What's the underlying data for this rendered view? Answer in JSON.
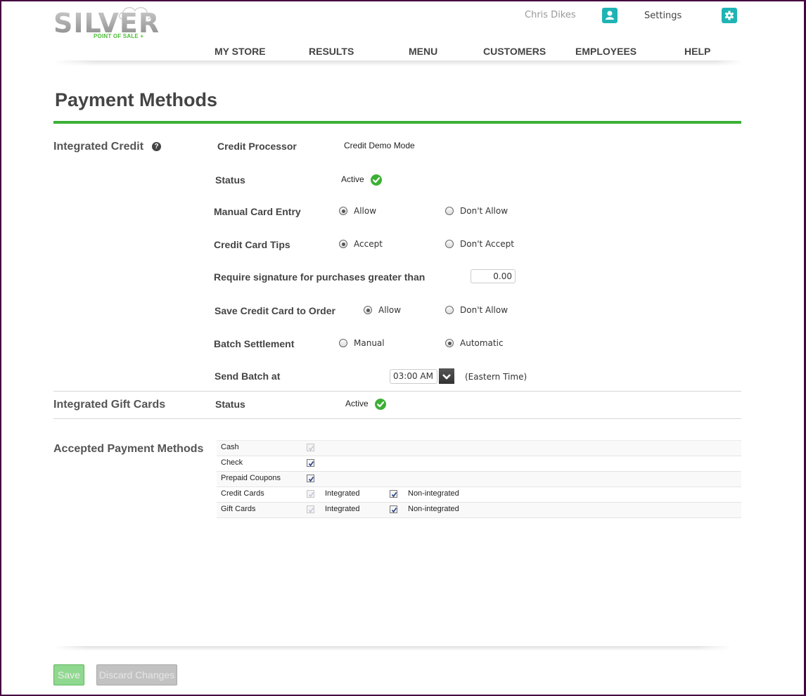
{
  "brand": {
    "name": "SILVER",
    "tagline": "POINT OF SALE +",
    "accent": "#3cb035",
    "teal": "#1fb4b4",
    "frame": "#44063f"
  },
  "header": {
    "user_name": "Chris Dikes",
    "user_icon": "user-icon",
    "settings_label": "Settings",
    "settings_icon": "gear-icon"
  },
  "nav": [
    "MY STORE",
    "RESULTS",
    "MENU",
    "CUSTOMERS",
    "EMPLOYEES",
    "HELP"
  ],
  "page_title": "Payment Methods",
  "integrated_credit": {
    "title": "Integrated Credit",
    "help_icon": "question-circle-icon",
    "credit_processor": {
      "label": "Credit Processor",
      "value": "Credit Demo Mode"
    },
    "status": {
      "label": "Status",
      "value": "Active",
      "icon": "check-circle-icon"
    },
    "manual_card_entry": {
      "label": "Manual Card Entry",
      "options": [
        "Allow",
        "Don't Allow"
      ],
      "selected": "Allow"
    },
    "credit_card_tips": {
      "label": "Credit Card Tips",
      "options": [
        "Accept",
        "Don't Accept"
      ],
      "selected": "Accept"
    },
    "require_signature": {
      "label": "Require signature for purchases greater than",
      "value": "0.00"
    },
    "save_card_to_order": {
      "label": "Save Credit Card to Order",
      "options": [
        "Allow",
        "Don't Allow"
      ],
      "selected": "Allow"
    },
    "batch_settlement": {
      "label": "Batch Settlement",
      "options": [
        "Manual",
        "Automatic"
      ],
      "selected": "Automatic"
    },
    "send_batch_at": {
      "label": "Send Batch at",
      "value": "03:00 AM",
      "timezone": "(Eastern Time)"
    }
  },
  "integrated_gift_cards": {
    "title": "Integrated Gift Cards",
    "status": {
      "label": "Status",
      "value": "Active"
    }
  },
  "accepted_payment_methods": {
    "title": "Accepted Payment Methods",
    "rows": [
      {
        "name": "Cash",
        "checked": true,
        "disabled": true
      },
      {
        "name": "Check",
        "checked": true,
        "disabled": false
      },
      {
        "name": "Prepaid Coupons",
        "checked": true,
        "disabled": false
      },
      {
        "name": "Credit Cards",
        "checked": true,
        "disabled": true,
        "integrated_label": "Integrated",
        "non_integrated_label": "Non-integrated",
        "non_integrated_checked": true
      },
      {
        "name": "Gift Cards",
        "checked": true,
        "disabled": true,
        "integrated_label": "Integrated",
        "non_integrated_label": "Non-integrated",
        "non_integrated_checked": true
      }
    ]
  },
  "footer": {
    "save_label": "Save",
    "discard_label": "Discard Changes"
  }
}
